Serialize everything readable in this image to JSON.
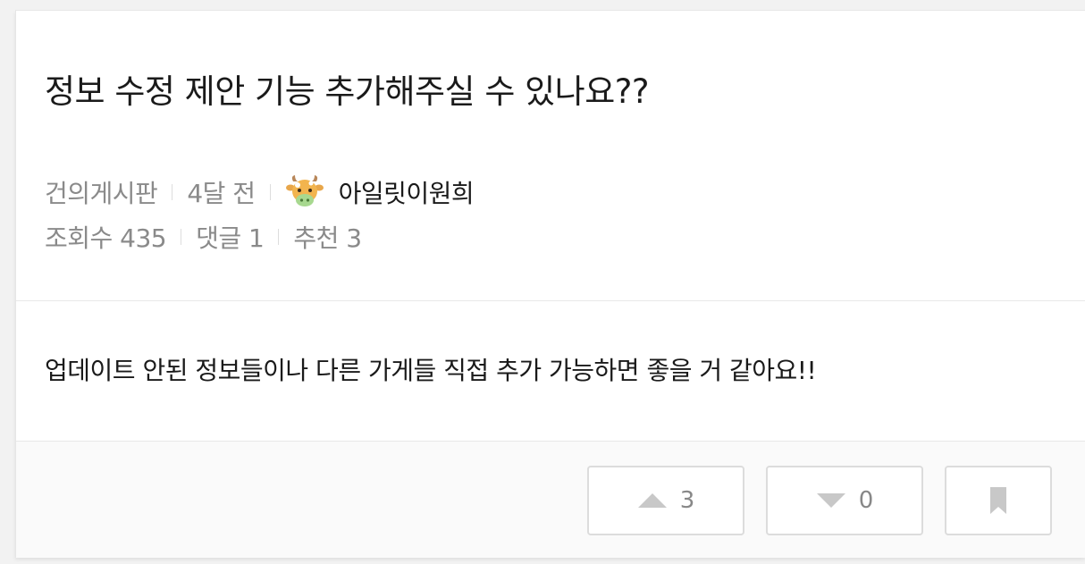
{
  "post": {
    "title": "정보 수정 제안 기능 추가해주실 수 있나요??",
    "board": "건의게시판",
    "time": "4달 전",
    "author": "아일릿이원희",
    "views_label": "조회수 435",
    "comments_label": "댓글 1",
    "likes_label": "추천 3",
    "body": "업데이트 안된 정보들이나 다른 가게들 직접 추가 가능하면 좋을 거 같아요!!"
  },
  "actions": {
    "upvote_count": "3",
    "downvote_count": "0"
  },
  "icons": {
    "avatar": "cow-avatar-icon",
    "upvote": "triangle-up-icon",
    "downvote": "triangle-down-icon",
    "bookmark": "bookmark-icon"
  },
  "colors": {
    "text": "#1a1a1a",
    "meta": "#8a8a8a",
    "icon": "#c8c8c8",
    "border": "#dcdcdc"
  }
}
